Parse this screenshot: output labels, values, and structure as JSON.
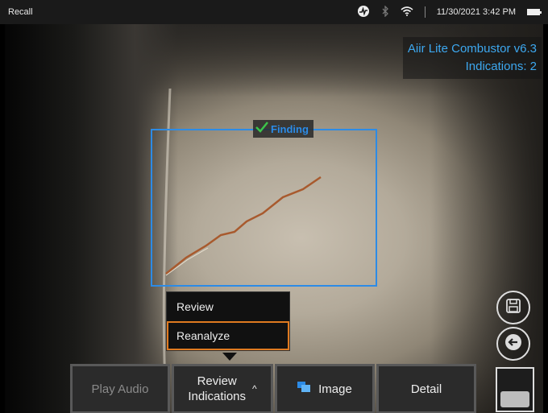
{
  "statusbar": {
    "title": "Recall",
    "datetime": "11/30/2021 3:42 PM",
    "icons": [
      "activity-icon",
      "bluetooth-icon",
      "wifi-icon",
      "battery-icon"
    ]
  },
  "overlay": {
    "model": "Aiir Lite Combustor v6.3",
    "indications": "Indications: 2"
  },
  "detection": {
    "label": "Finding",
    "color": "#2c8be6"
  },
  "menu": {
    "items": [
      {
        "label": "Review",
        "selected": false
      },
      {
        "label": "Reanalyze",
        "selected": true
      }
    ],
    "accent": "#e07a20"
  },
  "toolbar": {
    "play_audio": "Play Audio",
    "review_line1": "Review",
    "review_line2": "Indications",
    "review_caret": "^",
    "image": "Image",
    "detail": "Detail"
  },
  "side": {
    "save_icon": "save-icon",
    "back_icon": "back-arrow-icon"
  },
  "colors": {
    "accent_blue": "#3da8f0",
    "selection_orange": "#e07a20"
  }
}
